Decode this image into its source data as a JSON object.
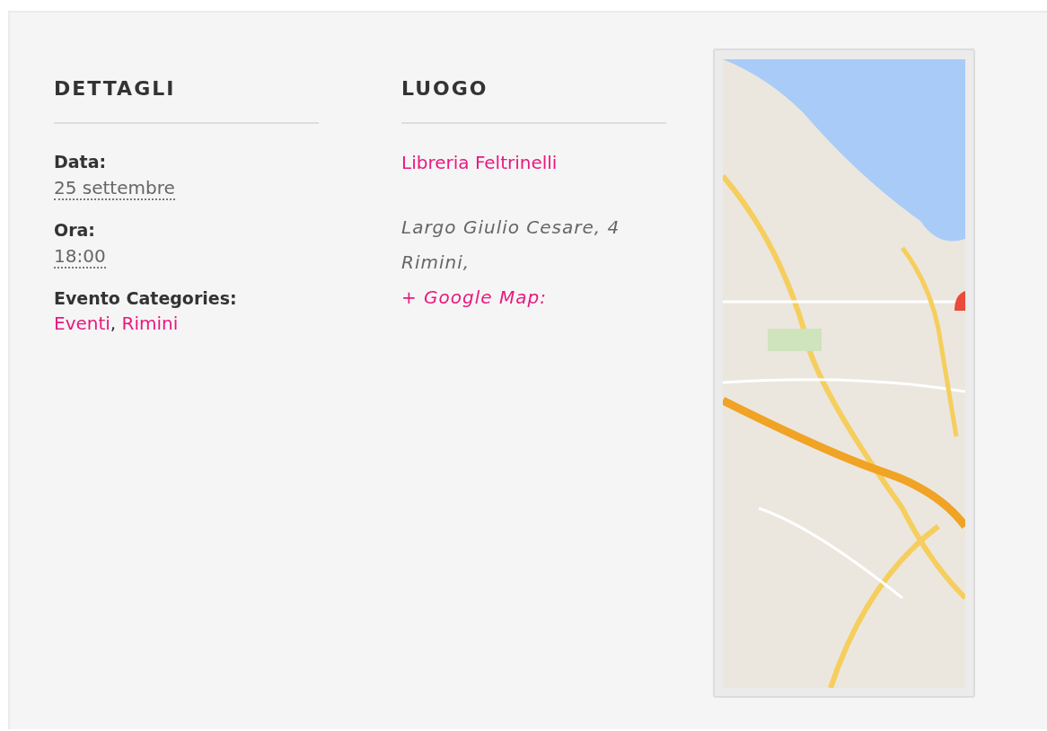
{
  "details": {
    "heading": "DETTAGLI",
    "fields": [
      {
        "label": "Data:",
        "value": "25 settembre"
      },
      {
        "label": "Ora:",
        "value": "18:00"
      }
    ],
    "categories": {
      "label": "Evento Categories:",
      "separator": ",",
      "links": [
        "Eventi",
        "Rimini"
      ]
    }
  },
  "venue": {
    "heading": "LUOGO",
    "name": "Libreria Feltrinelli",
    "address_lines": [
      "Largo Giulio Cesare, 4",
      "Rimini,"
    ],
    "map_link": "+ Google Map:"
  }
}
